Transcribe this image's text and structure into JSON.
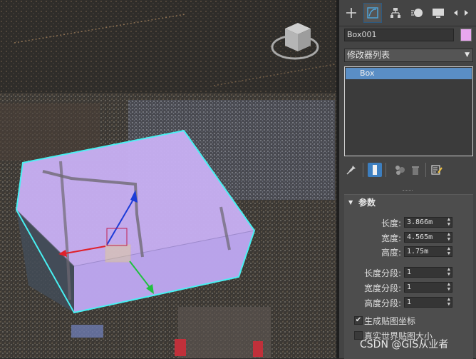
{
  "object": {
    "name": "Box001",
    "color": "#e9a7ef"
  },
  "command_panel": {
    "tabs": [
      {
        "id": "create",
        "icon": "plus-icon"
      },
      {
        "id": "modify",
        "icon": "modify-icon",
        "active": true
      },
      {
        "id": "hierarchy",
        "icon": "hierarchy-icon"
      },
      {
        "id": "motion",
        "icon": "motion-icon"
      },
      {
        "id": "display",
        "icon": "display-icon"
      }
    ],
    "modifier_list": "修改器列表",
    "stack": [
      "Box"
    ],
    "tool_icons": [
      "pin-icon",
      "show-end-result-icon",
      "make-unique-icon",
      "remove-modifier-icon",
      "configure-sets-icon"
    ]
  },
  "params": {
    "title": "参数",
    "length_label": "长度:",
    "length_value": "3.866m",
    "width_label": "宽度:",
    "width_value": "4.565m",
    "height_label": "高度:",
    "height_value": "1.75m",
    "length_segs_label": "长度分段:",
    "length_segs_value": "1",
    "width_segs_label": "宽度分段:",
    "width_segs_value": "1",
    "height_segs_label": "高度分段:",
    "height_segs_value": "1",
    "gen_mapping_label": "生成贴图坐标",
    "gen_mapping_checked": true,
    "real_world_label": "真实世界贴图大小",
    "real_world_checked": false
  },
  "viewport": {
    "selection_color": "#48f0f2",
    "box_color": "#c6aef2"
  },
  "watermark": "CSDN @GIS从业者"
}
